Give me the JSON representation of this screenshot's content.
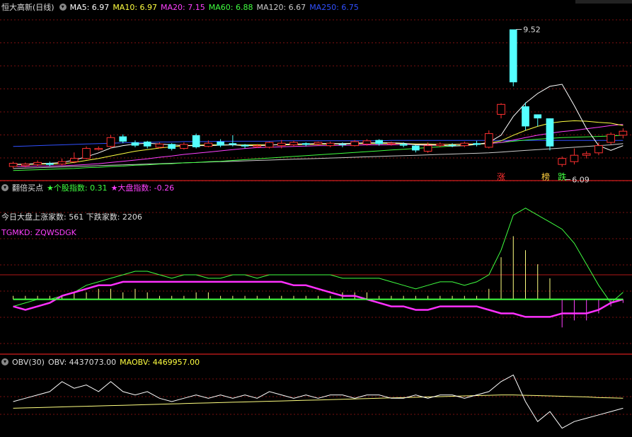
{
  "panel1": {
    "title": "恒大高新(日线)",
    "ma": [
      {
        "label": "MA5: 6.97",
        "color": "#ffffff"
      },
      {
        "label": "MA10: 6.97",
        "color": "#ffff40"
      },
      {
        "label": "MA20: 7.15",
        "color": "#ff40ff"
      },
      {
        "label": "MA60: 6.88",
        "color": "#40ff40"
      },
      {
        "label": "MA120: 6.67",
        "color": "#cccccc"
      },
      {
        "label": "MA250: 6.75",
        "color": "#3050ff"
      }
    ],
    "high_label": "9.52",
    "low_label": "6.09",
    "markers": [
      {
        "text": "涨",
        "color": "#ff3030"
      },
      {
        "text": "榜",
        "color": "#ffd040"
      },
      {
        "text": "跌",
        "color": "#40ff40"
      }
    ]
  },
  "panel2": {
    "title": "翻倍买点",
    "ind1": "★个股指数: 0.31",
    "ind2": "★大盘指数: -0.26",
    "ind1_color": "#40ff40",
    "ind2_color": "#ff40ff",
    "stats": "今日大盘上涨家数: 561 下跌家数: 2206",
    "formula": "TGMKD: ZQWSDGK"
  },
  "panel3": {
    "title": "OBV(30)",
    "obv": "OBV: 4437073.00",
    "maobv": "MAOBV: 4469957.00"
  },
  "chart_data": {
    "type": "line",
    "candles": [
      [
        6.1,
        6.18,
        6.05,
        6.22
      ],
      [
        6.12,
        6.16,
        6.08,
        6.2
      ],
      [
        6.15,
        6.2,
        6.1,
        6.25
      ],
      [
        6.18,
        6.14,
        6.1,
        6.22
      ],
      [
        6.16,
        6.22,
        6.12,
        6.3
      ],
      [
        6.22,
        6.3,
        6.18,
        6.45
      ],
      [
        6.3,
        6.55,
        6.28,
        6.6
      ],
      [
        6.55,
        6.55,
        6.5,
        6.6
      ],
      [
        6.6,
        6.82,
        6.55,
        6.88
      ],
      [
        6.85,
        6.72,
        6.68,
        6.9
      ],
      [
        6.7,
        6.62,
        6.58,
        6.75
      ],
      [
        6.72,
        6.6,
        6.55,
        6.74
      ],
      [
        6.58,
        6.66,
        6.55,
        6.7
      ],
      [
        6.66,
        6.54,
        6.5,
        6.68
      ],
      [
        6.55,
        6.65,
        6.52,
        6.7
      ],
      [
        6.88,
        6.58,
        6.55,
        6.92
      ],
      [
        6.6,
        6.68,
        6.58,
        6.75
      ],
      [
        6.72,
        6.62,
        6.58,
        6.78
      ],
      [
        6.68,
        6.64,
        6.6,
        6.88
      ],
      [
        6.64,
        6.6,
        6.55,
        6.66
      ],
      [
        6.6,
        6.62,
        6.56,
        6.66
      ],
      [
        6.58,
        6.7,
        6.55,
        6.72
      ],
      [
        6.62,
        6.68,
        6.55,
        6.76
      ],
      [
        6.64,
        6.7,
        6.6,
        6.74
      ],
      [
        6.68,
        6.64,
        6.6,
        6.7
      ],
      [
        6.66,
        6.7,
        6.62,
        6.72
      ],
      [
        6.62,
        6.68,
        6.58,
        6.72
      ],
      [
        6.66,
        6.64,
        6.58,
        6.7
      ],
      [
        6.62,
        6.72,
        6.6,
        6.76
      ],
      [
        6.66,
        6.74,
        6.62,
        6.78
      ],
      [
        6.76,
        6.66,
        6.62,
        6.78
      ],
      [
        6.66,
        6.68,
        6.62,
        6.72
      ],
      [
        6.66,
        6.62,
        6.58,
        6.7
      ],
      [
        6.62,
        6.5,
        6.45,
        6.64
      ],
      [
        6.48,
        6.62,
        6.44,
        6.7
      ],
      [
        6.62,
        6.66,
        6.58,
        6.7
      ],
      [
        6.64,
        6.62,
        6.58,
        6.68
      ],
      [
        6.62,
        6.68,
        6.58,
        6.72
      ],
      [
        6.68,
        6.64,
        6.6,
        6.74
      ],
      [
        6.58,
        6.92,
        6.55,
        7.0
      ],
      [
        7.4,
        7.65,
        7.3,
        7.68
      ],
      [
        9.52,
        8.2,
        8.1,
        9.52
      ],
      [
        7.6,
        7.1,
        7.0,
        7.7
      ],
      [
        7.4,
        7.3,
        7.1,
        7.4
      ],
      [
        7.3,
        6.6,
        6.5,
        7.3
      ],
      [
        6.15,
        6.3,
        6.09,
        6.35
      ],
      [
        6.22,
        6.38,
        6.15,
        6.55
      ],
      [
        6.38,
        6.42,
        6.3,
        6.48
      ],
      [
        6.44,
        6.62,
        6.38,
        6.7
      ],
      [
        6.7,
        6.9,
        6.65,
        6.95
      ],
      [
        6.88,
        6.98,
        6.8,
        7.05
      ]
    ],
    "price_ylim": [
      5.8,
      9.9
    ],
    "ma5": [
      6.15,
      6.16,
      6.17,
      6.18,
      6.2,
      6.26,
      6.34,
      6.44,
      6.56,
      6.62,
      6.66,
      6.68,
      6.66,
      6.64,
      6.62,
      6.62,
      6.62,
      6.63,
      6.64,
      6.62,
      6.62,
      6.63,
      6.65,
      6.66,
      6.66,
      6.67,
      6.67,
      6.67,
      6.68,
      6.69,
      6.69,
      6.69,
      6.68,
      6.64,
      6.63,
      6.63,
      6.61,
      6.62,
      6.65,
      6.7,
      6.88,
      7.35,
      7.68,
      7.92,
      8.1,
      8.15,
      7.62,
      7.05,
      6.62,
      6.5,
      6.62
    ],
    "ma10": [
      6.15,
      6.15,
      6.16,
      6.16,
      6.17,
      6.2,
      6.25,
      6.3,
      6.36,
      6.42,
      6.48,
      6.52,
      6.56,
      6.59,
      6.62,
      6.63,
      6.64,
      6.64,
      6.64,
      6.64,
      6.64,
      6.64,
      6.64,
      6.64,
      6.65,
      6.65,
      6.66,
      6.66,
      6.67,
      6.67,
      6.67,
      6.67,
      6.67,
      6.66,
      6.66,
      6.65,
      6.65,
      6.65,
      6.66,
      6.68,
      6.74,
      6.88,
      7.0,
      7.1,
      7.18,
      7.22,
      7.24,
      7.23,
      7.2,
      7.18,
      7.12
    ],
    "ma20": [
      6.1,
      6.1,
      6.11,
      6.11,
      6.12,
      6.13,
      6.15,
      6.17,
      6.2,
      6.23,
      6.26,
      6.29,
      6.33,
      6.36,
      6.4,
      6.43,
      6.46,
      6.49,
      6.52,
      6.55,
      6.57,
      6.58,
      6.59,
      6.6,
      6.61,
      6.62,
      6.62,
      6.63,
      6.63,
      6.64,
      6.64,
      6.64,
      6.65,
      6.65,
      6.65,
      6.65,
      6.65,
      6.66,
      6.66,
      6.67,
      6.7,
      6.76,
      6.82,
      6.88,
      6.93,
      6.97,
      7.0,
      7.04,
      7.08,
      7.12,
      7.15
    ],
    "ma60": [
      6.0,
      6.01,
      6.02,
      6.03,
      6.04,
      6.05,
      6.07,
      6.08,
      6.1,
      6.11,
      6.13,
      6.14,
      6.16,
      6.17,
      6.19,
      6.2,
      6.22,
      6.23,
      6.25,
      6.27,
      6.29,
      6.31,
      6.33,
      6.35,
      6.37,
      6.39,
      6.41,
      6.43,
      6.45,
      6.47,
      6.49,
      6.51,
      6.53,
      6.55,
      6.57,
      6.59,
      6.61,
      6.63,
      6.65,
      6.67,
      6.7,
      6.73,
      6.76,
      6.78,
      6.8,
      6.82,
      6.83,
      6.84,
      6.85,
      6.86,
      6.88
    ],
    "ma120": [
      6.05,
      6.06,
      6.07,
      6.08,
      6.09,
      6.1,
      6.11,
      6.12,
      6.13,
      6.14,
      6.15,
      6.16,
      6.17,
      6.18,
      6.19,
      6.2,
      6.21,
      6.22,
      6.23,
      6.24,
      6.25,
      6.26,
      6.27,
      6.28,
      6.29,
      6.3,
      6.31,
      6.32,
      6.33,
      6.34,
      6.35,
      6.36,
      6.37,
      6.38,
      6.39,
      6.4,
      6.41,
      6.42,
      6.43,
      6.44,
      6.46,
      6.48,
      6.5,
      6.52,
      6.54,
      6.56,
      6.58,
      6.6,
      6.62,
      6.64,
      6.67
    ],
    "ma250": [
      6.6,
      6.61,
      6.62,
      6.63,
      6.64,
      6.65,
      6.66,
      6.67,
      6.68,
      6.69,
      6.7,
      6.7,
      6.71,
      6.71,
      6.72,
      6.72,
      6.72,
      6.73,
      6.73,
      6.73,
      6.73,
      6.73,
      6.74,
      6.74,
      6.74,
      6.74,
      6.74,
      6.74,
      6.74,
      6.74,
      6.74,
      6.75,
      6.75,
      6.75,
      6.75,
      6.75,
      6.75,
      6.75,
      6.75,
      6.75,
      6.75,
      6.75,
      6.75,
      6.75,
      6.75,
      6.75,
      6.75,
      6.75,
      6.75,
      6.75,
      6.75
    ],
    "ind_green": [
      -2,
      -1,
      0,
      0,
      1,
      2,
      4,
      5,
      6,
      7,
      8,
      8,
      7,
      6,
      7,
      7,
      6,
      6,
      7,
      7,
      6,
      7,
      7,
      7,
      7,
      7,
      7,
      6,
      6,
      6,
      6,
      5,
      4,
      3,
      4,
      5,
      5,
      4,
      5,
      7,
      14,
      24,
      26,
      24,
      22,
      20,
      16,
      10,
      4,
      -1,
      2
    ],
    "ind_magenta": [
      -2,
      -3,
      -2,
      -1,
      1,
      2,
      3,
      4,
      4,
      5,
      5,
      5,
      5,
      5,
      5,
      5,
      5,
      5,
      5,
      5,
      5,
      5,
      5,
      4,
      4,
      3,
      2,
      1,
      1,
      0,
      -1,
      -2,
      -2,
      -3,
      -3,
      -2,
      -2,
      -2,
      -2,
      -3,
      -4,
      -4,
      -5,
      -5,
      -5,
      -4,
      -4,
      -4,
      -3,
      -1,
      0
    ],
    "ind_bars": [
      1,
      1,
      1,
      1,
      1,
      2,
      2,
      3,
      3,
      2,
      3,
      2,
      1,
      1,
      1,
      2,
      2,
      1,
      1,
      1,
      1,
      1,
      1,
      1,
      1,
      1,
      1,
      2,
      2,
      2,
      1,
      1,
      1,
      1,
      1,
      1,
      1,
      1,
      1,
      3,
      12,
      18,
      14,
      10,
      6,
      -8,
      -6,
      -6,
      -4,
      -2,
      -1
    ],
    "ind_ylim": [
      -15,
      30
    ],
    "obv": [
      4.46,
      4.47,
      4.48,
      4.49,
      4.52,
      4.5,
      4.51,
      4.49,
      4.52,
      4.49,
      4.48,
      4.49,
      4.47,
      4.46,
      4.47,
      4.48,
      4.47,
      4.48,
      4.47,
      4.48,
      4.47,
      4.49,
      4.48,
      4.47,
      4.48,
      4.47,
      4.48,
      4.48,
      4.47,
      4.48,
      4.48,
      4.47,
      4.47,
      4.48,
      4.47,
      4.48,
      4.48,
      4.47,
      4.48,
      4.49,
      4.52,
      4.54,
      4.46,
      4.4,
      4.43,
      4.38,
      4.4,
      4.41,
      4.42,
      4.43,
      4.44
    ],
    "maobv": [
      4.44,
      4.441,
      4.442,
      4.443,
      4.444,
      4.445,
      4.446,
      4.447,
      4.448,
      4.449,
      4.45,
      4.451,
      4.452,
      4.453,
      4.454,
      4.455,
      4.456,
      4.457,
      4.458,
      4.459,
      4.46,
      4.461,
      4.462,
      4.463,
      4.464,
      4.465,
      4.466,
      4.467,
      4.468,
      4.469,
      4.47,
      4.471,
      4.472,
      4.473,
      4.474,
      4.475,
      4.476,
      4.477,
      4.478,
      4.479,
      4.48,
      4.48,
      4.479,
      4.478,
      4.477,
      4.476,
      4.475,
      4.474,
      4.472,
      4.471,
      4.47
    ],
    "obv_ylim": [
      4.36,
      4.56
    ]
  }
}
